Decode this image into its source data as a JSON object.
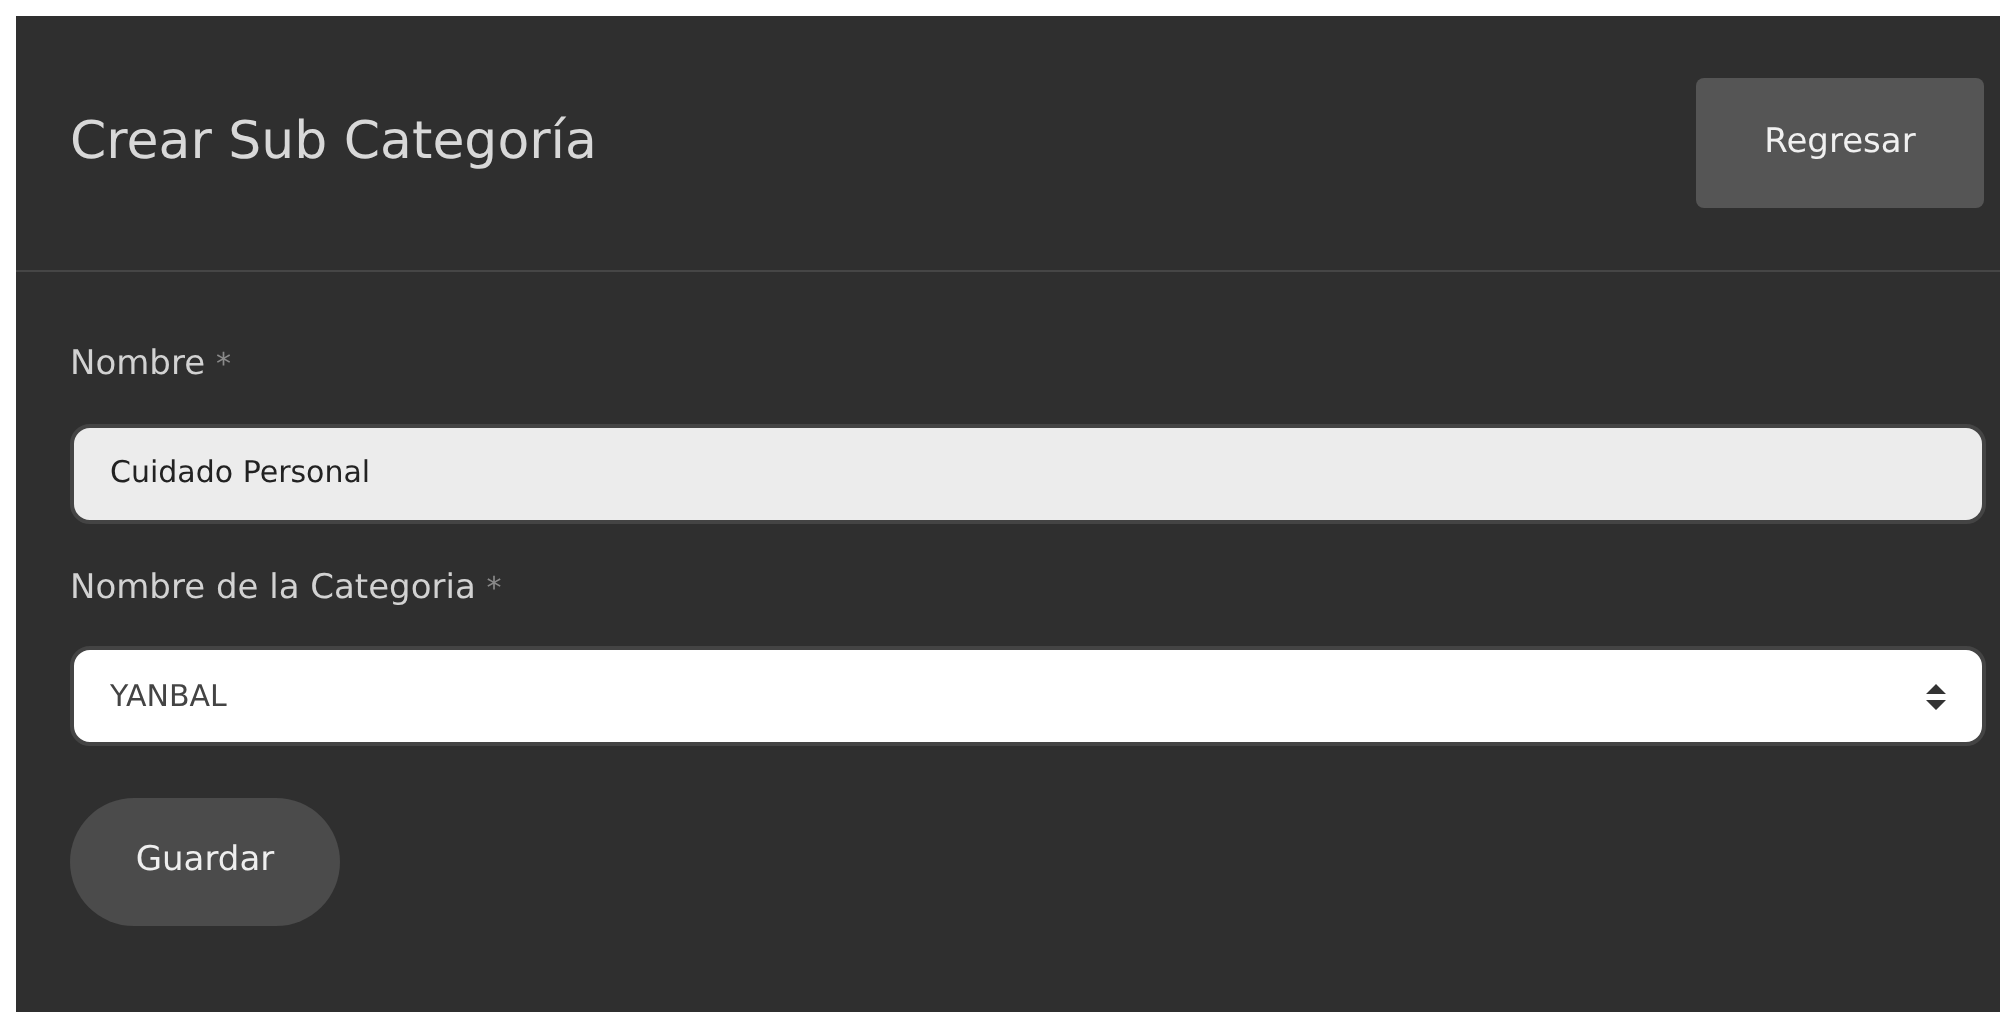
{
  "header": {
    "title": "Crear Sub Categoría",
    "back_button": "Regresar"
  },
  "fields": [
    {
      "kind": "text",
      "label": "Nombre",
      "required_mark": "*",
      "value": "Cuidado Personal"
    },
    {
      "kind": "select",
      "label": "Nombre de la Categoria",
      "required_mark": "*",
      "value": "YANBAL"
    }
  ],
  "submit_button": "Guardar"
}
